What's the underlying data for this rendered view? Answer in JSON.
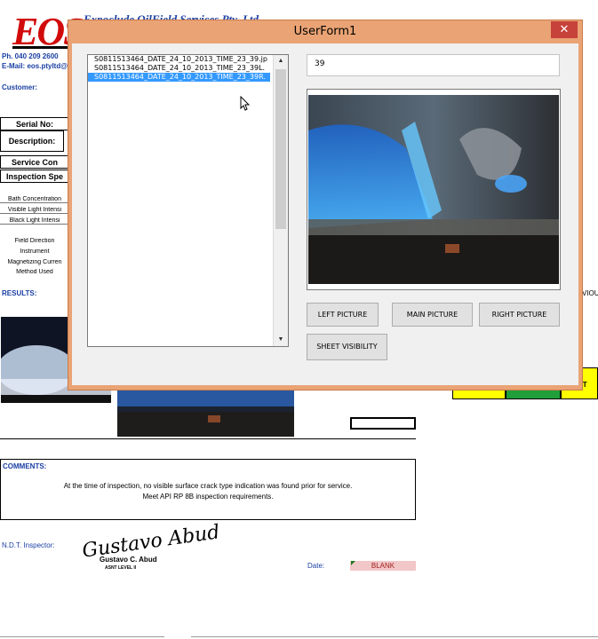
{
  "sheet": {
    "logo_text": "EOS",
    "company_name": "Expoclude OilField Services Pty. Ltd",
    "phone": "Ph. 040 209 2600",
    "email": "E-Mail: eos.ptyltd@",
    "customer_label": "Customer:",
    "serial_label": "Serial No:",
    "description_label": "Description:",
    "service_label": "Service Con",
    "inspection_label": "Inspection Spe",
    "small_rows": [
      "Bath Concentration",
      "Visible Light Intensi",
      "Black Light Intensi",
      "Field Direction",
      "Instrument",
      "Magnetizing Curren",
      "Method Used"
    ],
    "results_label": "RESULTS:",
    "right_text": "VIOU",
    "strip_text": "HT",
    "comments_label": "COMMENTS:",
    "comments_line1": "At the time of inspection, no visible surface crack type indication was found prior for service.",
    "comments_line2": "Meet API RP 8B inspection requirements.",
    "inspector_label": "N.D.T. Inspector:",
    "signature": "Gustavo Abud",
    "signature_name": "Gustavo C. Abud",
    "signature_level": "ASNT LEVEL II",
    "date_label": "Date:",
    "date_value": "BLANK",
    "colors": {
      "red": "#d10b0b",
      "blue": "#1a3fa3",
      "yellow": "#ffff00",
      "green": "#1f9e3a",
      "pink": "#f2c7c7"
    }
  },
  "userform": {
    "title": "UserForm1",
    "close_glyph": "✕",
    "list_items": [
      "S0811513464_DATE_24_10_2013_TIME_23_39.jp",
      "S0811513464_DATE_24_10_2013_TIME_23_39L.",
      "S0811513464_DATE_24_10_2013_TIME_23_39R."
    ],
    "selected_index": 2,
    "textbox_value": "39",
    "buttons": {
      "left": "LEFT PICTURE",
      "main": "MAIN PICTURE",
      "right": "RIGHT PICTURE",
      "sheet_visibility": "SHEET VISIBILITY"
    },
    "scroll_up": "▲",
    "scroll_down": "▼",
    "accent_color": "#eaa374",
    "selection_color": "#3399ff"
  }
}
